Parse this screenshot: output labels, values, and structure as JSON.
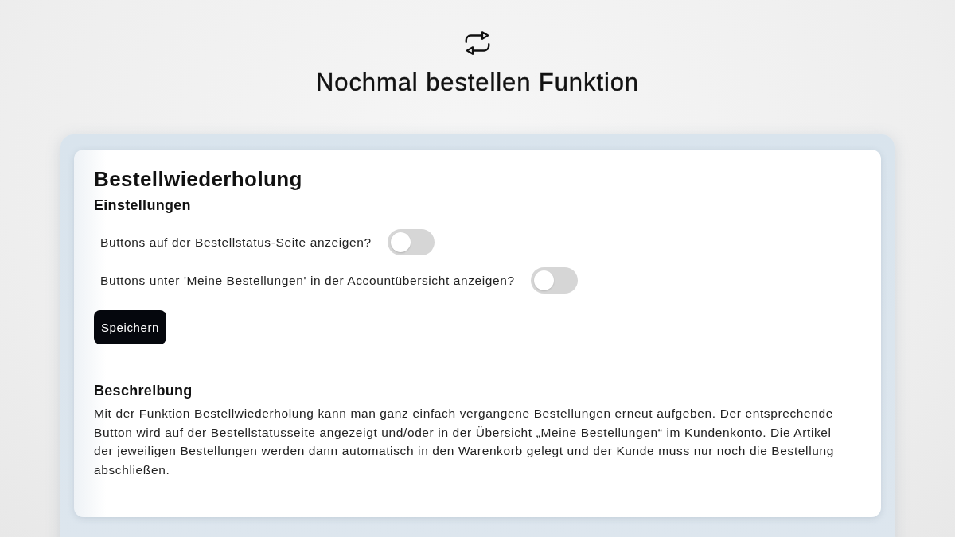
{
  "header": {
    "title": "Nochmal bestellen Funktion"
  },
  "card": {
    "title": "Bestellwiederholung",
    "settings": {
      "heading": "Einstellungen",
      "toggles": [
        {
          "label": "Buttons auf der Bestellstatus-Seite anzeigen?",
          "on": false
        },
        {
          "label": "Buttons unter 'Meine Bestellungen' in der Accountübersicht anzeigen?",
          "on": false
        }
      ],
      "save_button": "Speichern"
    },
    "description": {
      "heading": "Beschreibung",
      "text": "Mit der Funktion Bestellwiederholung kann man ganz einfach vergangene Bestellungen erneut aufgeben. Der entsprechende Button wird auf der Bestellstatusseite angezeigt und/oder in der Übersicht „Meine Bestellungen“ im Kundenkonto. Die Artikel der jeweiligen Bestellungen werden dann automatisch in den Warenkorb gelegt und der Kunde muss nur noch die Bestellung abschließen."
    }
  }
}
